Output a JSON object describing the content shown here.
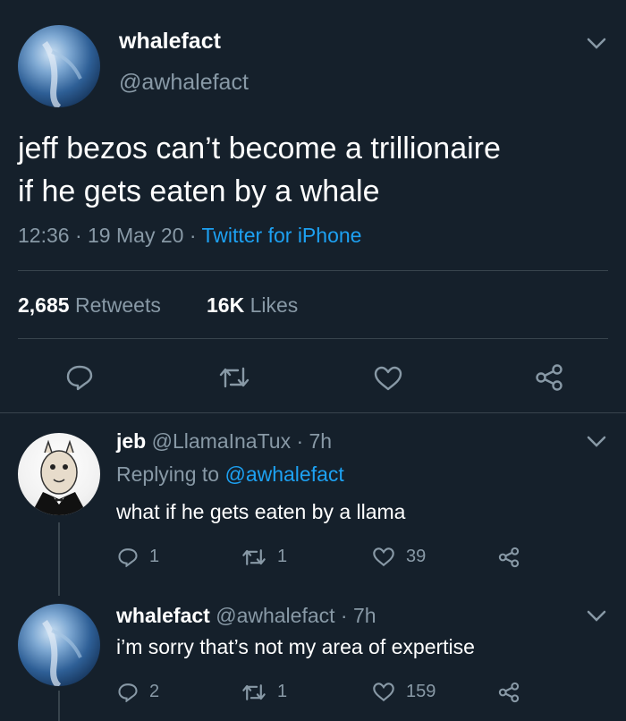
{
  "main_tweet": {
    "display_name": "whalefact",
    "handle": "@awhalefact",
    "text_line1": "jeff bezos can’t become a trillionaire",
    "text_line2": "if he gets eaten by a whale",
    "time": "12:36",
    "date": "19 May 20",
    "sep1": "·",
    "sep2": "·",
    "source": "Twitter for iPhone",
    "retweets_count": "2,685",
    "retweets_label": "Retweets",
    "likes_count": "16K",
    "likes_label": "Likes"
  },
  "replies": [
    {
      "display_name": "jeb",
      "handle_time": "@LlamaInaTux · 7h",
      "replying_label": "Replying to",
      "replying_to": "@awhalefact",
      "text": "what if he gets eaten by a llama",
      "reply_count": "1",
      "retweet_count": "1",
      "like_count": "39"
    },
    {
      "display_name": "whalefact",
      "handle_time": "@awhalefact · 7h",
      "text": "i’m sorry that’s not my area of expertise",
      "reply_count": "2",
      "retweet_count": "1",
      "like_count": "159"
    }
  ],
  "colors": {
    "background": "#15202b",
    "muted": "#8899a6",
    "link": "#1da1f2",
    "divider": "#38444d"
  },
  "icons": [
    "chevron-down-icon",
    "reply-icon",
    "retweet-icon",
    "like-icon",
    "share-icon"
  ]
}
